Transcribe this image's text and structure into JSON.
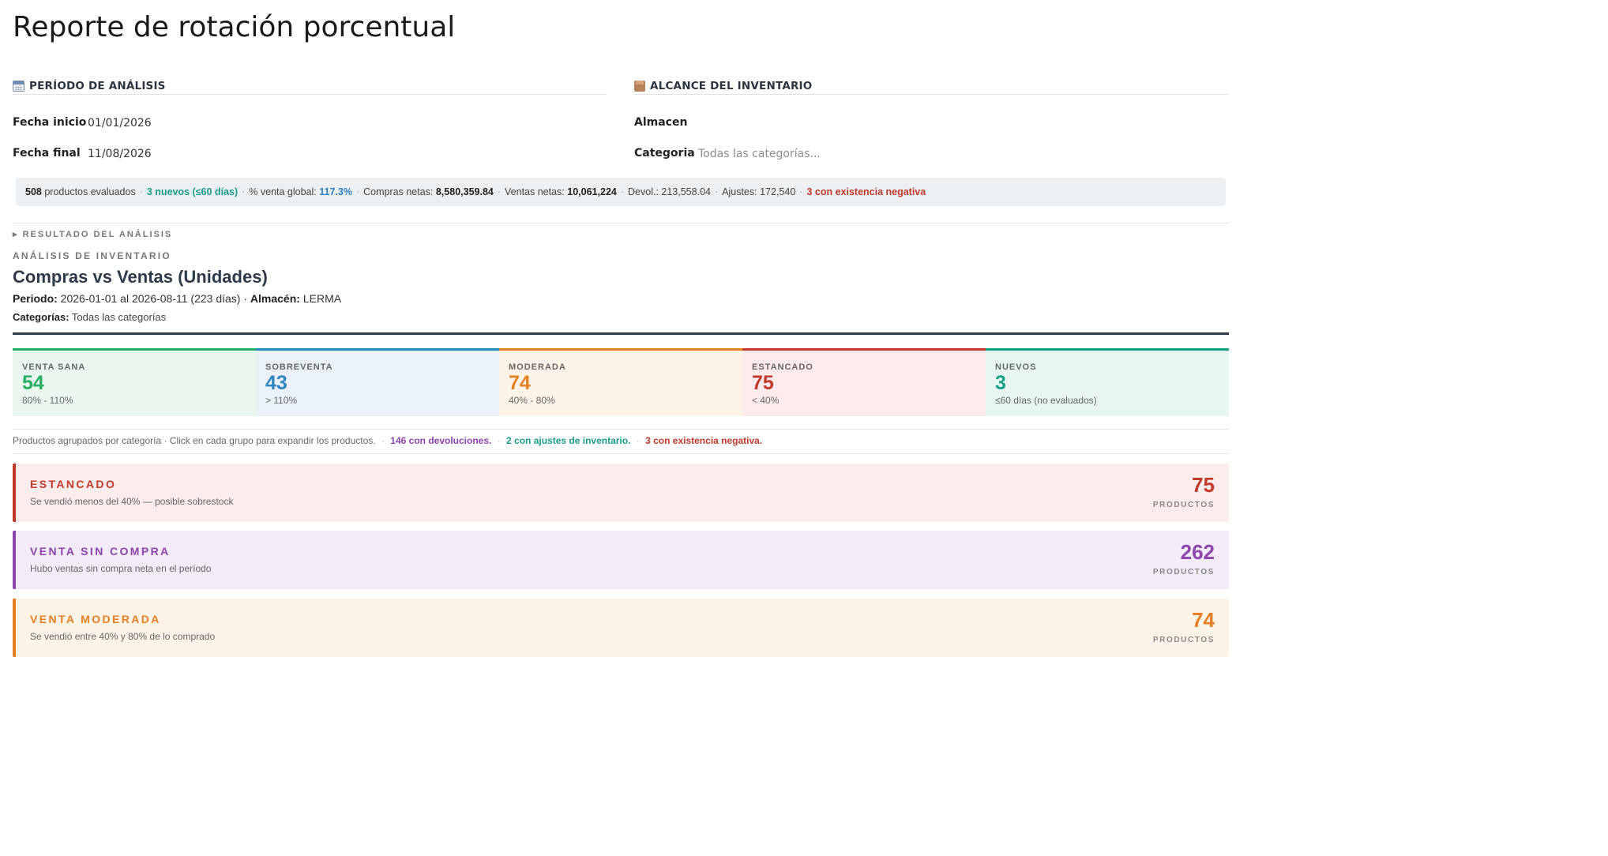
{
  "page": {
    "title": "Reporte de rotación porcentual"
  },
  "period": {
    "heading": "PERÍODO DE ANÁLISIS",
    "icon": "calendar-icon",
    "start_label": "Fecha inicio",
    "start_value": "01/01/2026",
    "end_label": "Fecha final",
    "end_value": "11/08/2026"
  },
  "scope": {
    "heading": "ALCANCE DEL INVENTARIO",
    "icon": "package-icon",
    "warehouse_label": "Almacen",
    "warehouse_value": "",
    "category_label": "Categoria",
    "category_placeholder": "Todas las categorías..."
  },
  "summary": {
    "products_count": "508",
    "products_text": "productos evaluados",
    "new_text": "3 nuevos (≤60 días)",
    "global_label": "% venta global:",
    "global_value": "117.3%",
    "purchases_label": "Compras netas:",
    "purchases_value": "8,580,359.84",
    "sales_label": "Ventas netas:",
    "sales_value": "10,061,224",
    "returns_label": "Devol.:",
    "returns_value": "213,558.04",
    "adjust_label": "Ajustes:",
    "adjust_value": "172,540",
    "negative_text": "3 con existencia negativa",
    "sep": "·"
  },
  "result": {
    "toggle": "▸ RESULTADO DEL ANÁLISIS",
    "kicker": "ANÁLISIS DE INVENTARIO",
    "title": "Compras vs Ventas (Unidades)",
    "period_label": "Periodo:",
    "period_value": "2026-01-01 al 2026-08-11 (223 días) ·",
    "warehouse_label": "Almacén:",
    "warehouse_value": "LERMA",
    "categories_label": "Categorías:",
    "categories_value": "Todas las categorías"
  },
  "kpis": [
    {
      "label": "VENTA SANA",
      "value": "54",
      "range": "80% - 110%",
      "color": "#27ae60",
      "bg": "#eaf7ef"
    },
    {
      "label": "SOBREVENTA",
      "value": "43",
      "range": "> 110%",
      "color": "#2e86c1",
      "bg": "#eaf1f8"
    },
    {
      "label": "MODERADA",
      "value": "74",
      "range": "40% - 80%",
      "color": "#e67e22",
      "bg": "#fdf4e7"
    },
    {
      "label": "ESTANCADO",
      "value": "75",
      "range": "< 40%",
      "color": "#c0392b",
      "bg": "#fcebea"
    },
    {
      "label": "NUEVOS",
      "value": "3",
      "range": "≤60 días (no evaluados)",
      "color": "#16a085",
      "bg": "#e8f6f2"
    }
  ],
  "note": {
    "text": "Productos agrupados por categoría · Click en cada grupo para expandir los productos.",
    "sep": "·",
    "returns": "146 con devoluciones.",
    "adjustments": "2 con ajustes de inventario.",
    "negative": "3 con existencia negativa."
  },
  "groups": [
    {
      "title": "ESTANCADO",
      "subtitle": "Se vendió menos del 40% — posible sobrestock",
      "count": "75",
      "unit": "PRODUCTOS",
      "color": "#c0392b",
      "bg": "#fcecec"
    },
    {
      "title": "VENTA SIN COMPRA",
      "subtitle": "Hubo ventas sin compra neta en el período",
      "count": "262",
      "unit": "PRODUCTOS",
      "color": "#8e44ad",
      "bg": "#f3ebf7"
    },
    {
      "title": "VENTA MODERADA",
      "subtitle": "Se vendió entre 40% y 80% de lo comprado",
      "count": "74",
      "unit": "PRODUCTOS",
      "color": "#e67e22",
      "bg": "#fdf4e7"
    }
  ]
}
